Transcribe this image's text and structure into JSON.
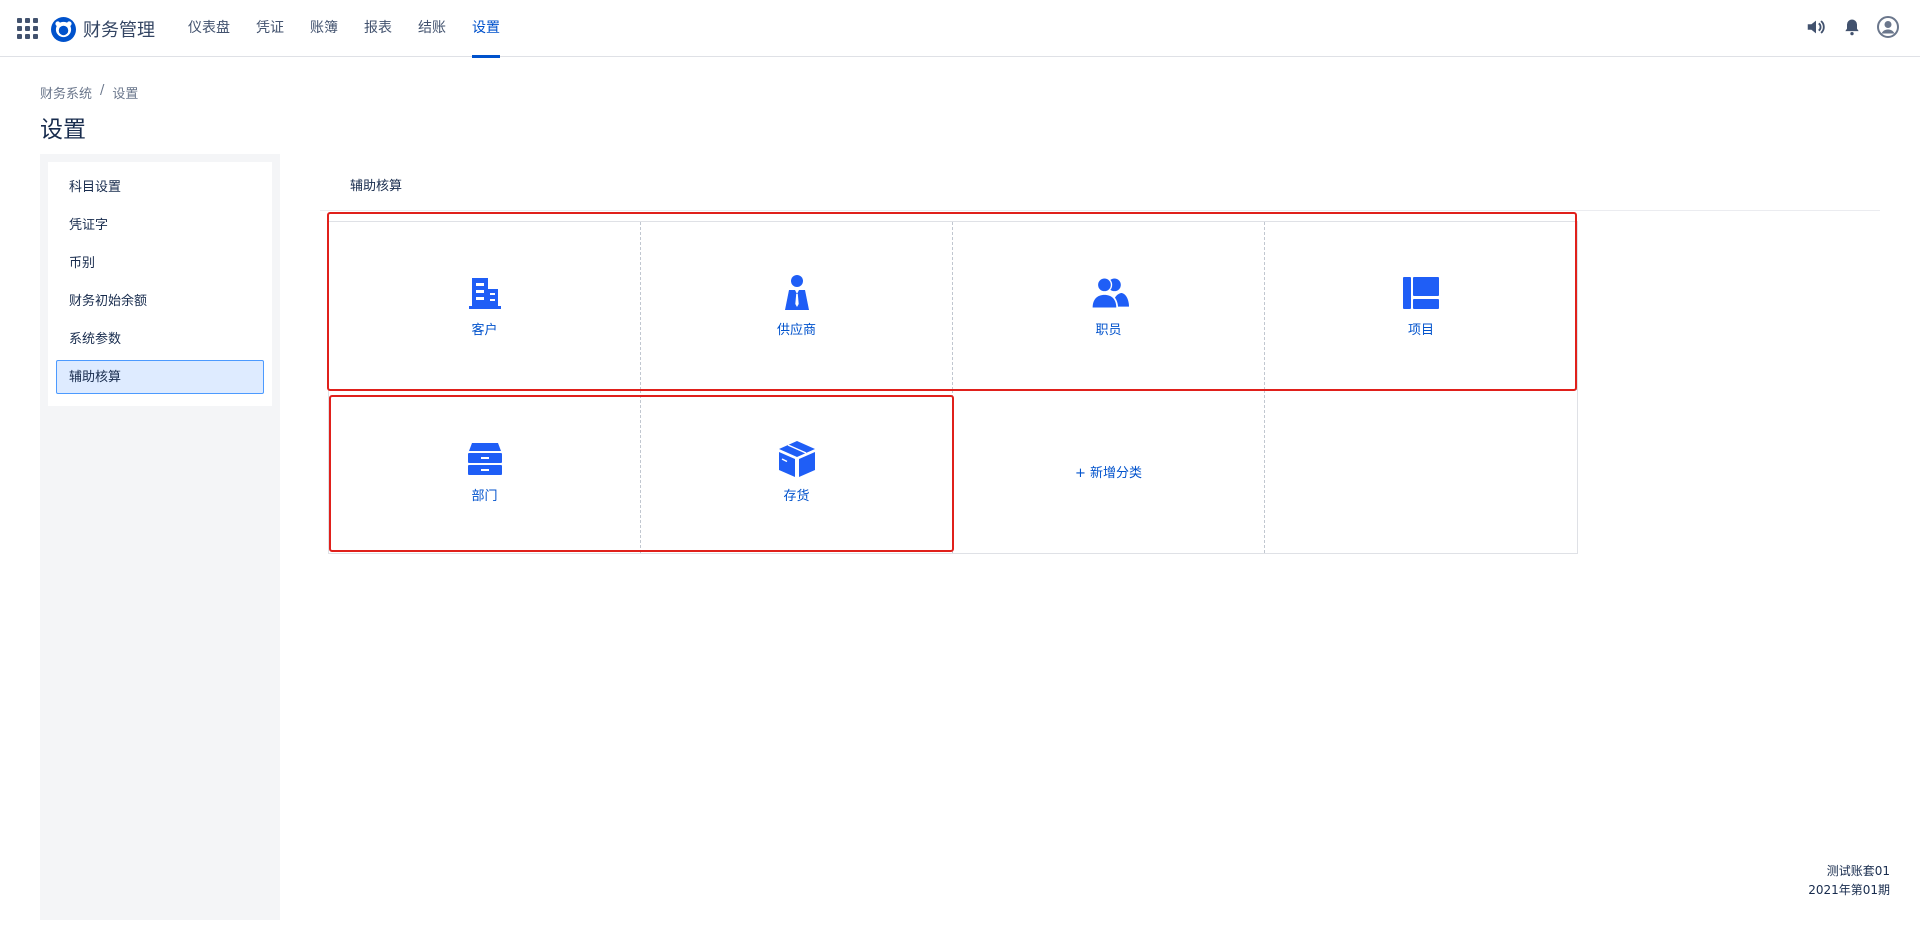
{
  "app": {
    "name": "财务管理"
  },
  "nav": {
    "items": [
      {
        "label": "仪表盘"
      },
      {
        "label": "凭证"
      },
      {
        "label": "账簿"
      },
      {
        "label": "报表"
      },
      {
        "label": "结账"
      },
      {
        "label": "设置"
      }
    ],
    "active_index": 5
  },
  "topbar": {
    "icons": [
      "volume-icon",
      "bell-icon",
      "user-icon"
    ]
  },
  "breadcrumb": {
    "root": "财务系统",
    "separator": "/",
    "current": "设置"
  },
  "page": {
    "title": "设置"
  },
  "sidebar": {
    "items": [
      {
        "label": "科目设置"
      },
      {
        "label": "凭证字"
      },
      {
        "label": "币别"
      },
      {
        "label": "财务初始余额"
      },
      {
        "label": "系统参数"
      },
      {
        "label": "辅助核算"
      }
    ],
    "active_index": 5
  },
  "section": {
    "title": "辅助核算"
  },
  "categories": [
    {
      "label": "客户",
      "icon": "building-icon"
    },
    {
      "label": "供应商",
      "icon": "supplier-person-icon"
    },
    {
      "label": "职员",
      "icon": "users-icon"
    },
    {
      "label": "项目",
      "icon": "project-board-icon"
    },
    {
      "label": "部门",
      "icon": "drawer-cabinet-icon"
    },
    {
      "label": "存货",
      "icon": "box-icon"
    }
  ],
  "add_category": {
    "label": "+ 新增分类"
  },
  "footer": {
    "account": "测试账套01",
    "period": "2021年第01期"
  },
  "colors": {
    "primary": "#0052cc",
    "icon_blue": "#1f5ef6",
    "highlight_red": "#e0201b",
    "sidebar_bg": "#f4f5f7"
  }
}
